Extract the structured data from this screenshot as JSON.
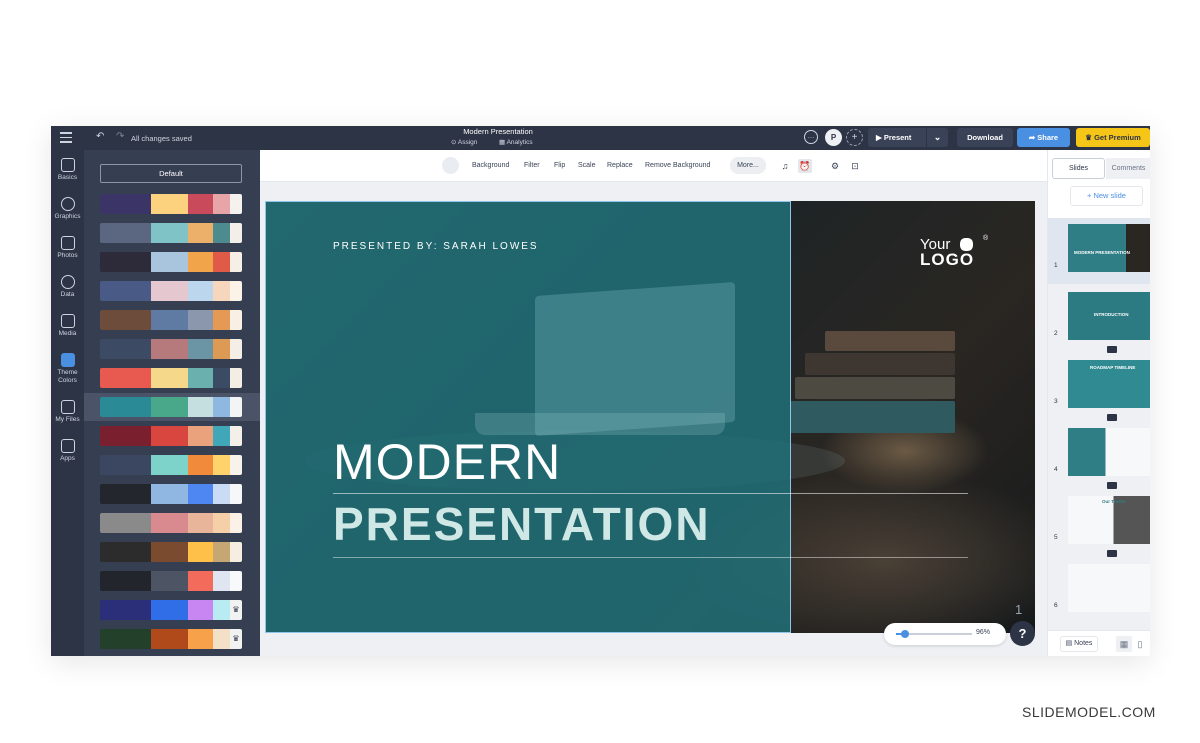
{
  "topbar": {
    "saved_status": "All changes saved",
    "doc_title": "Modern Presentation",
    "assign": "Assign",
    "analytics": "Analytics",
    "avatar_initial": "P",
    "present": "Present",
    "download": "Download",
    "share": "Share",
    "premium": "Get Premium"
  },
  "rail": {
    "items": [
      {
        "label": "Basics",
        "icon": "text-icon"
      },
      {
        "label": "Graphics",
        "icon": "shapes-icon"
      },
      {
        "label": "Photos",
        "icon": "photo-icon"
      },
      {
        "label": "Data",
        "icon": "pie-chart-icon"
      },
      {
        "label": "Media",
        "icon": "media-icon"
      },
      {
        "label": "Theme Colors",
        "icon": "palette-icon"
      },
      {
        "label": "My Files",
        "icon": "folder-icon"
      },
      {
        "label": "Apps",
        "icon": "apps-icon"
      }
    ]
  },
  "panel": {
    "default_label": "Default",
    "selected_index": 7,
    "palettes": [
      [
        "#3a3566",
        "#fdd27e",
        "#c94a5a",
        "#e7a5a8",
        "#f4f1ee"
      ],
      [
        "#5b6680",
        "#7fc3c6",
        "#edb06a",
        "#4e8b8f",
        "#f3efe8"
      ],
      [
        "#2d2a3a",
        "#a9c4dd",
        "#f2a44a",
        "#e05a48",
        "#f5efe6"
      ],
      [
        "#4a5a86",
        "#e4c7cf",
        "#bcd6ee",
        "#f6d6bc",
        "#fbf2e8"
      ],
      [
        "#6e4c3c",
        "#5f7aa3",
        "#8b97ac",
        "#e49a55",
        "#f8efe5"
      ],
      [
        "#3d4a63",
        "#b6797c",
        "#6b95a4",
        "#dd9a55",
        "#f4eee6"
      ],
      [
        "#e85a4f",
        "#f6d88b",
        "#6ab0ae",
        "#3b4b63",
        "#f3ede3"
      ],
      [
        "#2a8a96",
        "#4aa88a",
        "#c5dfe0",
        "#8fb8e0",
        "#f2f4f6"
      ],
      [
        "#7a1f2d",
        "#d9453f",
        "#e9a27c",
        "#3fa7b8",
        "#f4efe9"
      ],
      [
        "#3b4660",
        "#7dd3c9",
        "#f28a3b",
        "#ffd36b",
        "#f7f3ea"
      ],
      [
        "#24262e",
        "#8fb7e2",
        "#4e86f2",
        "#c9dbf5",
        "#f6f7f9"
      ],
      [
        "#8a8a8a",
        "#d98a8f",
        "#e8b49a",
        "#f4cfa8",
        "#fbf1e6"
      ],
      [
        "#2c2c2c",
        "#7a4b2e",
        "#ffc04a",
        "#c4a772",
        "#f6eee0"
      ],
      [
        "#23252d",
        "#4d5464",
        "#f26b5b",
        "#dfe6f2",
        "#f8f9fb"
      ],
      [
        "#2b2f7a",
        "#2f6ee6",
        "#c886f2",
        "#b8ecf2",
        "crown"
      ],
      [
        "#23402a",
        "#b04a1a",
        "#f7a24a",
        "#f4dfc7",
        "crown"
      ],
      [
        "#3a3f55",
        "#4ec0e8",
        "#7ae0c0",
        "#f2e9a5",
        "#f7f3e8"
      ]
    ]
  },
  "context_toolbar": {
    "background": "Background",
    "filter": "Filter",
    "flip": "Flip",
    "scale": "Scale",
    "replace": "Replace",
    "remove_bg": "Remove Background",
    "more": "More..."
  },
  "slide": {
    "presented_by": "PRESENTED BY: SARAH LOWES",
    "logo_line1": "Your",
    "logo_line2": "LOGO",
    "logo_mark": "®",
    "title_line1": "MODERN",
    "title_line2": "PRESENTATION",
    "page_number": "1"
  },
  "zoom": {
    "value": "96%",
    "level": 0.12
  },
  "help": "?",
  "right_panel": {
    "tab_slides": "Slides",
    "tab_comments": "Comments",
    "new_slide": "+ New slide",
    "notes": "Notes",
    "thumbnails": [
      {
        "num": "1",
        "title": "MODERN PRESENTATION"
      },
      {
        "num": "2",
        "title": "INTRODUCTION"
      },
      {
        "num": "3",
        "title": "ROADMAP TIMELINE"
      },
      {
        "num": "4",
        "title": ""
      },
      {
        "num": "5",
        "title": "Our Theme"
      },
      {
        "num": "6",
        "title": ""
      }
    ]
  },
  "watermark": "SLIDEMODEL.COM",
  "colors": {
    "dark_chrome": "#2d3446",
    "panel_bg": "#363e52",
    "accent_blue": "#4a90e2",
    "premium_yellow": "#f5c518",
    "teal_overlay": "#217078"
  }
}
